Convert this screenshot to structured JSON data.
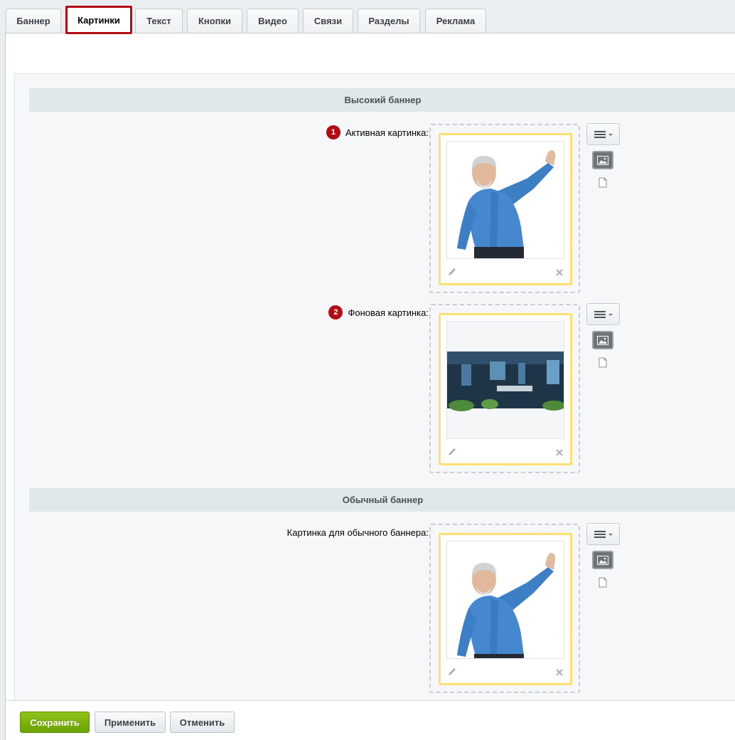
{
  "tabs": [
    {
      "label": "Баннер",
      "active": false
    },
    {
      "label": "Картинки",
      "active": true
    },
    {
      "label": "Текст",
      "active": false
    },
    {
      "label": "Кнопки",
      "active": false
    },
    {
      "label": "Видео",
      "active": false
    },
    {
      "label": "Связи",
      "active": false
    },
    {
      "label": "Разделы",
      "active": false
    },
    {
      "label": "Реклама",
      "active": false
    }
  ],
  "sections": {
    "tall_banner": {
      "title": "Высокий баннер",
      "fields": [
        {
          "marker": "1",
          "label": "Активная картинка:",
          "image": "man-pointing-photo"
        },
        {
          "marker": "2",
          "label": "Фоновая картинка:",
          "image": "office-interior-photo"
        }
      ]
    },
    "normal_banner": {
      "title": "Обычный баннер",
      "fields": [
        {
          "label": "Картинка для обычного баннера:",
          "image": "man-pointing-photo"
        }
      ]
    }
  },
  "footer": {
    "save_label": "Сохранить",
    "apply_label": "Применить",
    "cancel_label": "Отменить"
  },
  "colors": {
    "active_tab_border": "#b20d14",
    "marker_badge": "#b20d14",
    "card_border": "#ffe070",
    "save_button": "#7ab20c"
  }
}
